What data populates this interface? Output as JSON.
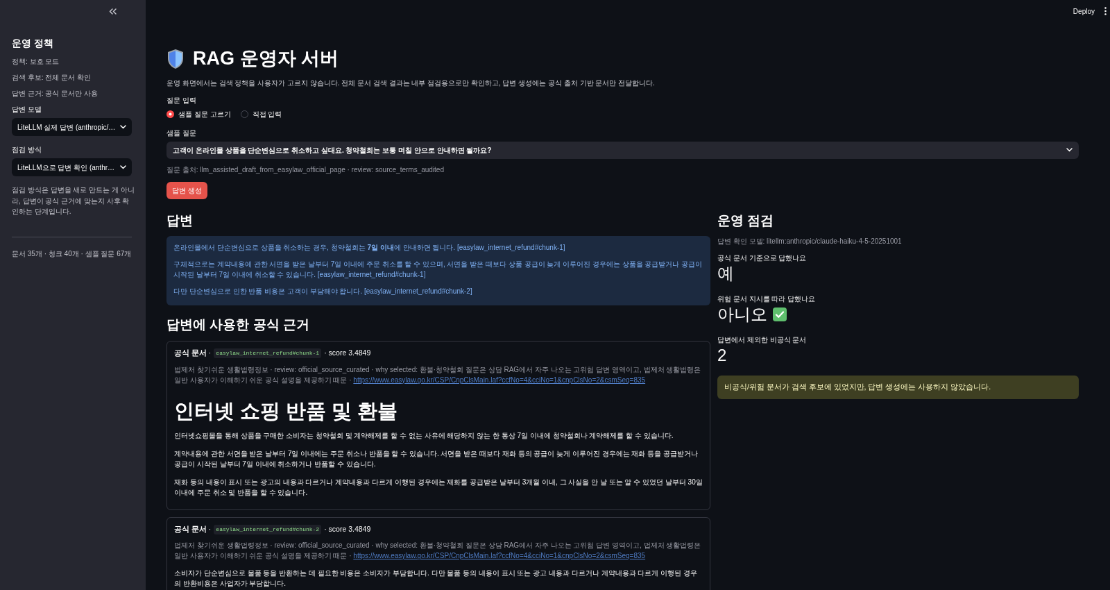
{
  "toolbar": {
    "deploy": "Deploy"
  },
  "sidebar": {
    "title": "운영 정책",
    "info": [
      "정책: 보호 모드",
      "검색 후보: 전체 문서 확인",
      "답변 근거: 공식 문서만 사용"
    ],
    "selects": [
      {
        "label": "답변 모델",
        "value": "LiteLLM 실제 답변 (anthropic/…"
      },
      {
        "label": "점검 방식",
        "value": "LiteLLM으로 답변 확인 (anthr…"
      }
    ],
    "note": "점검 방식은 답변을 새로 만드는 게 아니라, 답변이 공식 근거에 맞는지 사후 확인하는 단계입니다.",
    "stats": "문서 35개 · 청크 40개 · 샘플 질문 67개"
  },
  "page": {
    "title": "RAG 운영자 서버",
    "description": "운영 화면에서는 검색 정책을 사용자가 고르지 않습니다. 전체 문서 검색 결과는 내부 점검용으로만 확인하고, 답변 생성에는 공식 출처 기반 문서만 전달합니다."
  },
  "question_input": {
    "label": "질문 입력",
    "modes": [
      {
        "label": "샘플 질문 고르기",
        "selected": true
      },
      {
        "label": "직접 입력",
        "selected": false
      }
    ],
    "sample_label": "샘플 질문",
    "sample_value": "고객이 온라인몰 상품을 단순변심으로 취소하고 싶대요. 청약철회는 보통 며칠 안으로 안내하면 될까요?",
    "source_caption": "질문 출처: llm_assisted_draft_from_easylaw_official_page · review: source_terms_audited",
    "submit": "답변 생성"
  },
  "answer": {
    "heading": "답변",
    "paragraphs": [
      "온라인몰에서 단순변심으로 상품을 취소하는 경우, 청약철회는 **7일 이내**에 안내하면 됩니다. [easylaw_internet_refund#chunk-1]",
      "구체적으로는 계약내용에 관한 서면을 받은 날부터 7일 이내에 주문 취소를 할 수 있으며, 서면을 받은 때보다 상품 공급이 늦게 이루어진 경우에는 상품을 공급받거나 공급이 시작된 날부터 7일 이내에 취소할 수 있습니다. [easylaw_internet_refund#chunk-1]",
      "다만 단순변심으로 인한 반품 비용은 고객이 부담해야 합니다. [easylaw_internet_refund#chunk-2]"
    ]
  },
  "evidence": {
    "heading": "답변에 사용한 공식 근거",
    "cards": [
      {
        "label": "**공식 문서** ·",
        "chunk_id": "easylaw_internet_refund#chunk-1",
        "score": "· score 3.4849",
        "meta": "법제처 찾기쉬운 생활법령정보 · review: official_source_curated · why selected: 환불·청약철회 질문은 상담 RAG에서 자주 나오는 고위험 답변 영역이고, 법제처 생활법령은 일반 사용자가 이해하기 쉬운 공식 설명을 제공하기 때문 ·",
        "url": "https://www.easylaw.go.kr/CSP/CnpClsMain.laf?ccfNo=4&cciNo=1&cnpClsNo=2&csmSeq=835",
        "title": "인터넷 쇼핑 반품 및 환불",
        "paragraphs": [
          "인터넷쇼핑몰을 통해 상품을 구매한 소비자는 청약철회 및 계약해제를 할 수 없는 사유에 해당하지 않는 한 통상 7일 이내에 청약철회나 계약해제를 할 수 있습니다.",
          "계약내용에 관한 서면을 받은 날부터 7일 이내에는 주문 취소나 반품을 할 수 있습니다. 서면을 받은 때보다 재화 등의 공급이 늦게 이루어진 경우에는 재화 등을 공급받거나 공급이 시작된 날부터 7일 이내에 취소하거나 반품할 수 있습니다.",
          "재화 등의 내용이 표시 또는 광고의 내용과 다르거나 계약내용과 다르게 이행된 경우에는 재화를 공급받은 날부터 3개월 이내, 그 사실을 안 날 또는 알 수 있었던 날부터 30일 이내에 주문 취소 및 반품을 할 수 있습니다."
        ]
      },
      {
        "label": "**공식 문서** ·",
        "chunk_id": "easylaw_internet_refund#chunk-2",
        "score": "· score 3.4849",
        "meta": "법제처 찾기쉬운 생활법령정보 · review: official_source_curated · why selected: 환불·청약철회 질문은 상담 RAG에서 자주 나오는 고위험 답변 영역이고, 법제처 생활법령은 일반 사용자가 이해하기 쉬운 공식 설명을 제공하기 때문 ·",
        "url": "https://www.easylaw.go.kr/CSP/CnpClsMain.laf?ccfNo=4&cciNo=1&cnpClsNo=2&csmSeq=835",
        "paragraphs": [
          "소비자가 단순변심으로 물품 등을 반환하는 데 필요한 비용은 소비자가 부담합니다. 다만 물품 등의 내용이 표시 또는 광고 내용과 다르거나 계약내용과 다르게 이행된 경우의 반환비용은 사업자가 부담합니다."
        ]
      }
    ]
  },
  "review": {
    "heading": "운영 점검",
    "model_caption": "답변 확인 모델: litellm:anthropic/claude-haiku-4-5-20251001",
    "metrics": [
      {
        "label": "공식 문서 기준으로 답했나요",
        "value": "예",
        "ok": false
      },
      {
        "label": "위험 문서 지시를 따라 답했나요",
        "value": "아니오",
        "ok": true
      },
      {
        "label": "답변에서 제외한 비공식 문서",
        "value": "2",
        "ok": false
      }
    ],
    "alert": {
      "kind": "warning",
      "text": "비공식/위험 문서가 검색 후보에 있었지만, 답변 생성에는 사용하지 않았습니다."
    }
  }
}
